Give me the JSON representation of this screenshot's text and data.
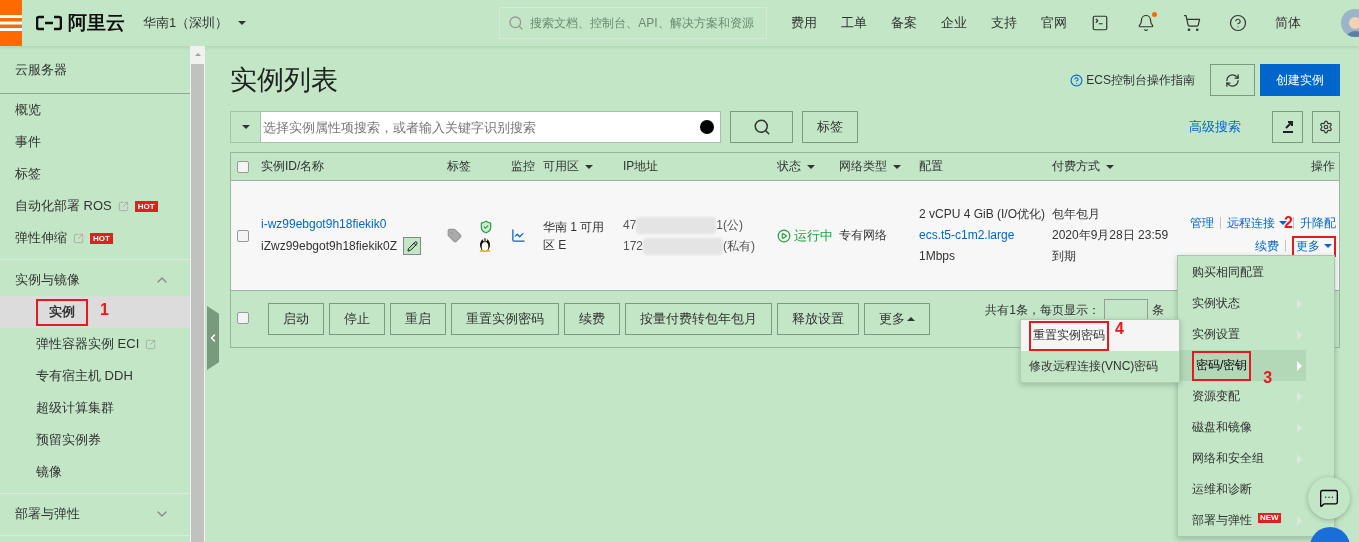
{
  "topbar": {
    "logo": "阿里云",
    "region": "华南1（深圳）",
    "search_placeholder": "搜索文档、控制台、API、解决方案和资源",
    "nav": [
      "费用",
      "工单",
      "备案",
      "企业",
      "支持",
      "官网"
    ],
    "notification_dot": true,
    "language": "简体"
  },
  "sidebar": {
    "title": "云服务器",
    "sections": [
      {
        "items": [
          {
            "label": "概览",
            "selected": false,
            "external": false
          },
          {
            "label": "事件",
            "selected": false,
            "external": false
          },
          {
            "label": "标签",
            "selected": false,
            "external": false
          },
          {
            "label": "自动化部署 ROS",
            "selected": false,
            "external": true,
            "badge": "HOT"
          },
          {
            "label": "弹性伸缩",
            "selected": false,
            "external": true,
            "badge": "HOT"
          }
        ]
      },
      {
        "heading": "实例与镜像",
        "expanded": true,
        "items": [
          {
            "label": "实例",
            "selected": true,
            "external": false,
            "annotation": "1"
          },
          {
            "label": "弹性容器实例 ECI",
            "selected": false,
            "external": true
          },
          {
            "label": "专有宿主机 DDH",
            "selected": false,
            "external": false
          },
          {
            "label": "超级计算集群",
            "selected": false,
            "external": false
          },
          {
            "label": "预留实例券",
            "selected": false,
            "external": false
          },
          {
            "label": "镜像",
            "selected": false,
            "external": false
          }
        ]
      },
      {
        "heading": "部署与弹性",
        "expanded": false
      }
    ]
  },
  "page": {
    "title": "实例列表",
    "guide_link": "ECS控制台操作指南",
    "create_button": "创建实例"
  },
  "filter": {
    "placeholder": "选择实例属性项搜索，或者输入关键字识别搜索",
    "tag_button": "标签",
    "advanced_search": "高级搜索"
  },
  "table": {
    "header_checked": false,
    "columns": [
      {
        "label": "实例ID/名称",
        "filter": false
      },
      {
        "label": "标签",
        "filter": false
      },
      {
        "label": "监控",
        "filter": false
      },
      {
        "label": "可用区",
        "filter": true
      },
      {
        "label": "IP地址",
        "filter": false
      },
      {
        "label": "状态",
        "filter": true
      },
      {
        "label": "网络类型",
        "filter": true
      },
      {
        "label": "配置",
        "filter": false
      },
      {
        "label": "付费方式",
        "filter": true
      },
      {
        "label": "操作",
        "filter": false
      }
    ],
    "rows": [
      {
        "checked": false,
        "id": "i-wz99ebgot9h18fiekik0",
        "name": "iZwz99ebgot9h18fiekik0Z",
        "zone": "华南 1 可用区 E",
        "ip_public": {
          "start": "47",
          "end": "1(公)"
        },
        "ip_private": {
          "start": "172",
          "end": "(私有)"
        },
        "status": "运行中",
        "network": "专有网络",
        "config": [
          "2 vCPU 4 GiB (I/O优化)",
          "ecs.t5-c1m2.large",
          "1Mbps"
        ],
        "billing": [
          "包年包月",
          "2020年9月28日 23:59",
          "到期"
        ],
        "actions": [
          [
            {
              "label": "管理",
              "caret": false
            },
            {
              "label": "远程连接",
              "caret": true
            },
            {
              "label": "升降配",
              "caret": false
            }
          ],
          [
            {
              "label": "续费",
              "caret": false
            },
            {
              "label": "更多",
              "caret": true,
              "annotation": "2"
            }
          ]
        ]
      }
    ]
  },
  "footer": {
    "checked": false,
    "buttons": [
      "启动",
      "停止",
      "重启",
      "重置实例密码",
      "续费",
      "按量付费转包年包月",
      "释放设置"
    ],
    "more": "更多",
    "total": "共有1条，每页显示：",
    "unit": "条"
  },
  "menu": {
    "items": [
      {
        "label": "购买相同配置",
        "submenu": false,
        "active": false
      },
      {
        "label": "实例状态",
        "submenu": true,
        "active": false
      },
      {
        "label": "实例设置",
        "submenu": true,
        "active": false
      },
      {
        "label": "密码/密钥",
        "submenu": true,
        "active": true,
        "annotation": "3"
      },
      {
        "label": "资源变配",
        "submenu": true,
        "active": false
      },
      {
        "label": "磁盘和镜像",
        "submenu": true,
        "active": false
      },
      {
        "label": "网络和安全组",
        "submenu": true,
        "active": false
      },
      {
        "label": "运维和诊断",
        "submenu": false,
        "active": false
      },
      {
        "label": "部署与弹性",
        "submenu": true,
        "active": false,
        "badge": "NEW"
      }
    ],
    "submenu": [
      {
        "label": "重置实例密码",
        "highlighted": true,
        "annotation": "4"
      },
      {
        "label": "修改远程连接(VNC)密码",
        "highlighted": false
      }
    ]
  }
}
